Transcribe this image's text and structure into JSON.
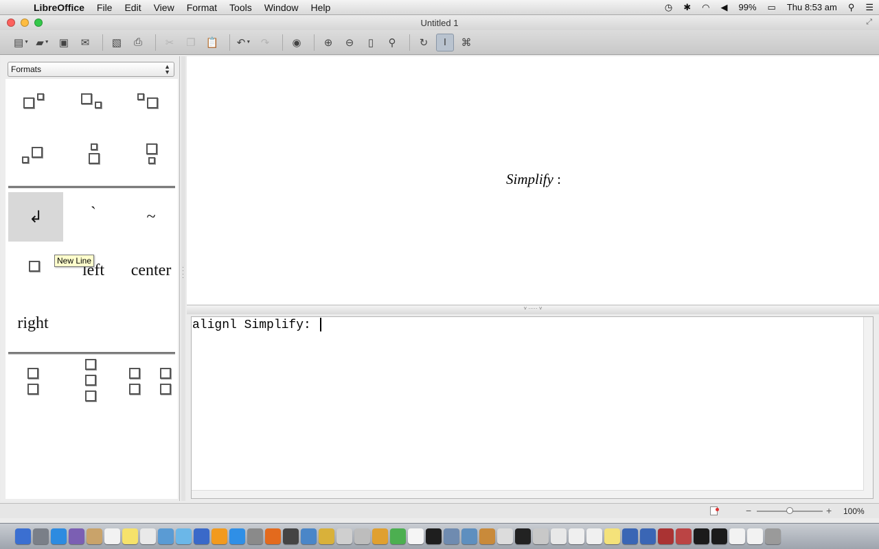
{
  "menubar": {
    "app_name": "LibreOffice",
    "items": [
      "File",
      "Edit",
      "View",
      "Format",
      "Tools",
      "Window",
      "Help"
    ],
    "battery": "99%",
    "clock": "Thu 8:53 am"
  },
  "window": {
    "title": "Untitled 1"
  },
  "sidebar": {
    "category_select": "Formats",
    "elements": {
      "align_left_label": "left",
      "align_center_label": "center",
      "align_right_label": "right",
      "new_line_glyph": "↲",
      "small_space_glyph": "`",
      "blank_glyph": "~"
    }
  },
  "tooltip": "New Line",
  "preview": {
    "formula_text": "Simplify",
    "formula_suffix": " :"
  },
  "editor": {
    "command_text": "alignl Simplify: "
  },
  "statusbar": {
    "zoom": "100%",
    "zoom_level_percent": 100
  },
  "colors": {
    "selected_cell": "#d8d8d8",
    "tooltip_bg": "#ffffcc",
    "close": "#fc615d",
    "minimize": "#fdbc40",
    "zoom": "#34c84a"
  }
}
